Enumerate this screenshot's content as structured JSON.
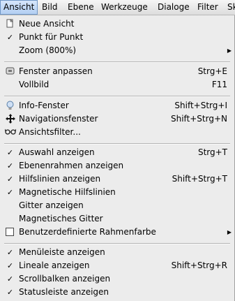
{
  "menubar": [
    "Ansicht",
    "Bild",
    "Ebene",
    "Werkzeuge",
    "Dialoge",
    "Filter",
    "Sk"
  ],
  "menu": {
    "neue_ansicht": "Neue Ansicht",
    "punkt_fuer_punkt": "Punkt für Punkt",
    "zoom": "Zoom (800%)",
    "fenster_anpassen": "Fenster anpassen",
    "fenster_anpassen_accel": "Strg+E",
    "vollbild": "Vollbild",
    "vollbild_accel": "F11",
    "info_fenster": "Info-Fenster",
    "info_fenster_accel": "Shift+Strg+I",
    "navigationsfenster": "Navigationsfenster",
    "navigationsfenster_accel": "Shift+Strg+N",
    "ansichtsfilter": "Ansichtsfilter...",
    "auswahl_anzeigen": "Auswahl anzeigen",
    "auswahl_anzeigen_accel": "Strg+T",
    "ebenenrahmen": "Ebenenrahmen anzeigen",
    "hilfslinien": "Hilfslinien anzeigen",
    "hilfslinien_accel": "Shift+Strg+T",
    "magnetische_hilfslinien": "Magnetische Hilfslinien",
    "gitter_anzeigen": "Gitter anzeigen",
    "magnetisches_gitter": "Magnetisches Gitter",
    "rahmenfarbe": "Benutzerdefinierte Rahmenfarbe",
    "menueleiste": "Menüleiste anzeigen",
    "lineale": "Lineale anzeigen",
    "lineale_accel": "Shift+Strg+R",
    "scrollbalken": "Scrollbalken anzeigen",
    "statusleiste": "Statusleiste anzeigen"
  }
}
